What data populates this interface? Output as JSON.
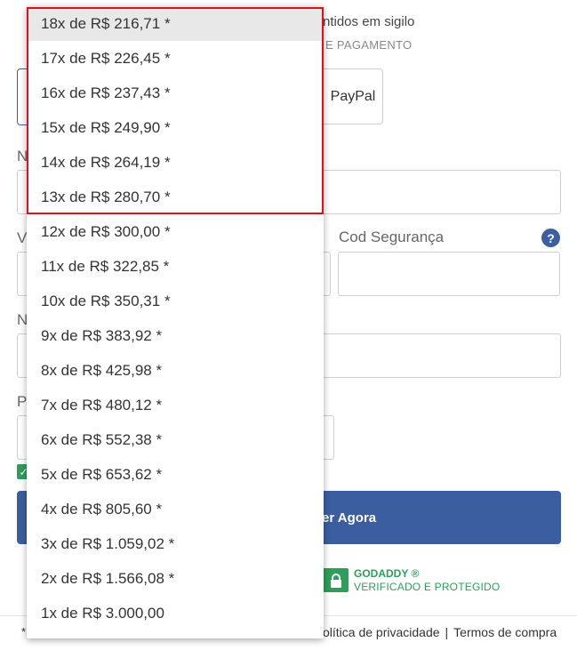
{
  "header": {
    "secure_text": "ntidos em sigilo",
    "payment_method_text": "E PAGAMENTO"
  },
  "payment_methods": {
    "paypal_label": "PayPal"
  },
  "form": {
    "stub_n1": "N",
    "stub_v": "V",
    "stub_n2": "N",
    "stub_p": "P",
    "cod_label": "Cod Segurança",
    "help_icon": "?"
  },
  "buy_button": {
    "label": "er Agora"
  },
  "godaddy": {
    "title": "GODADDY ®",
    "subtitle": "VERIFICADO E PROTEGIDO"
  },
  "footer": {
    "asterisk": "*",
    "privacy": "olítica de privacidade",
    "separator": "|",
    "terms": "Termos de compra"
  },
  "installments": {
    "selected_index": 0,
    "options": [
      "18x de R$ 216,71 *",
      "17x de R$ 226,45 *",
      "16x de R$ 237,43 *",
      "15x de R$ 249,90 *",
      "14x de R$ 264,19 *",
      "13x de R$ 280,70 *",
      "12x de R$ 300,00 *",
      "11x de R$ 322,85 *",
      "10x de R$ 350,31 *",
      "9x de R$ 383,92 *",
      "8x de R$ 425,98 *",
      "7x de R$ 480,12 *",
      "6x de R$ 552,38 *",
      "5x de R$ 653,62 *",
      "4x de R$ 805,60 *",
      "3x de R$ 1.059,02 *",
      "2x de R$ 1.566,08 *",
      "1x de R$ 3.000,00"
    ]
  },
  "colors": {
    "brand_blue": "#3a5ea0",
    "godaddy_green": "#2e9e5a",
    "highlight_red": "#d9121b"
  }
}
